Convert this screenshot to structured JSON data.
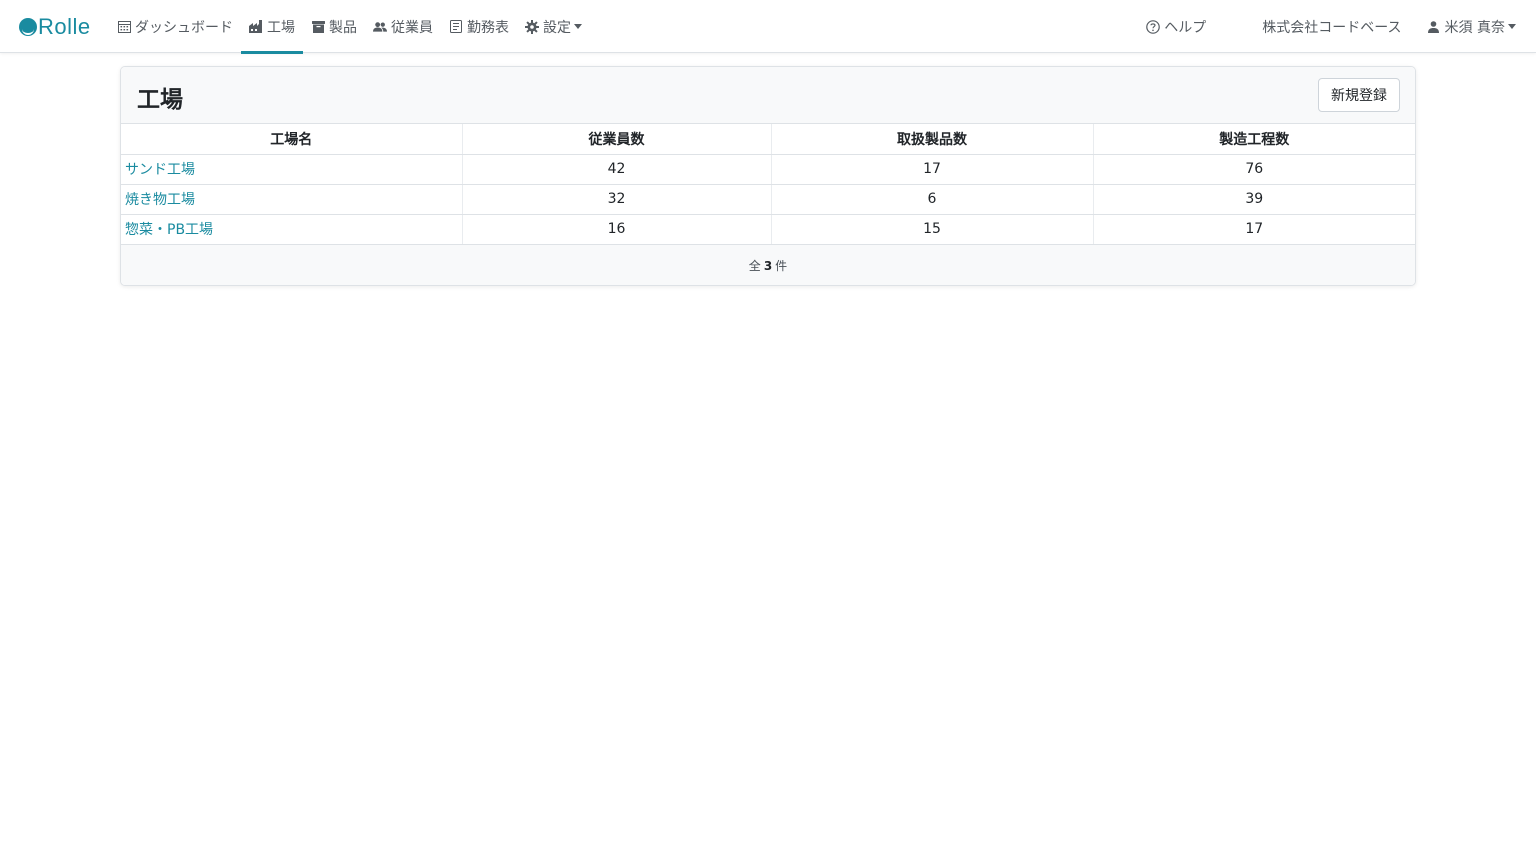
{
  "brand": {
    "name": "Rolle"
  },
  "nav": {
    "items": [
      {
        "label": "ダッシュボード",
        "icon": "calendar-icon"
      },
      {
        "label": "工場",
        "icon": "factory-icon",
        "active": true
      },
      {
        "label": "製品",
        "icon": "box-icon"
      },
      {
        "label": "従業員",
        "icon": "users-icon"
      },
      {
        "label": "勤務表",
        "icon": "document-icon"
      },
      {
        "label": "設定",
        "icon": "gear-icon"
      }
    ],
    "help": "ヘルプ",
    "company": "株式会社コードベース",
    "user": "米須 真奈"
  },
  "page": {
    "title": "工場",
    "new_button": "新規登録",
    "table": {
      "headers": [
        "工場名",
        "従業員数",
        "取扱製品数",
        "製造工程数"
      ],
      "rows": [
        [
          "サンド工場",
          "42",
          "17",
          "76"
        ],
        [
          "焼き物工場",
          "32",
          "6",
          "39"
        ],
        [
          "惣菜・PB工場",
          "16",
          "15",
          "17"
        ]
      ]
    },
    "footer": {
      "prefix": "全",
      "count": "3",
      "suffix": "件"
    }
  },
  "colors": {
    "accent": "#1a8ba0",
    "border": "#dee2e6",
    "header_bg": "#f8f9fa"
  }
}
